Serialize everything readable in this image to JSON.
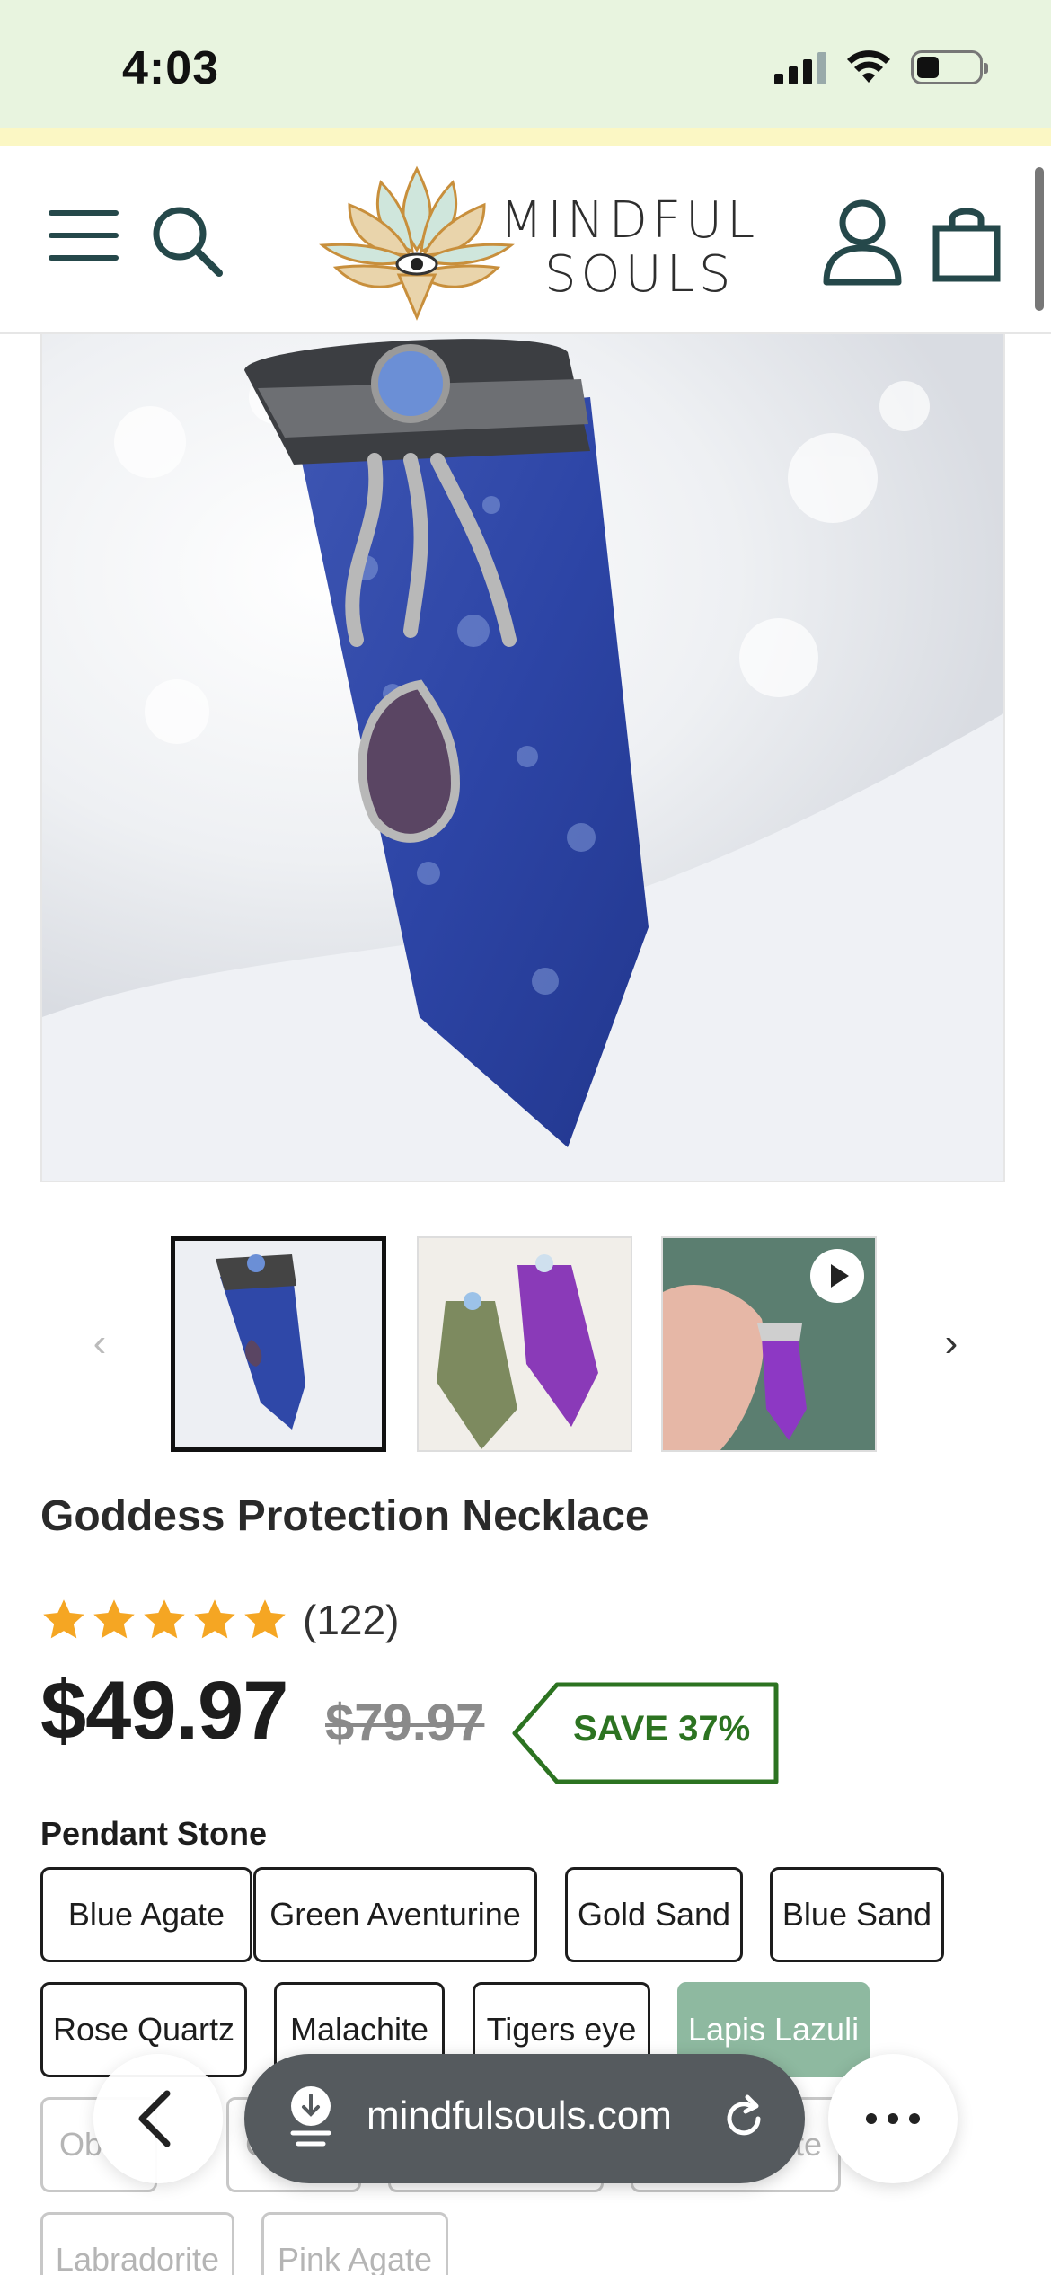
{
  "status_bar": {
    "time": "4:03"
  },
  "header": {
    "brand_line1": "MINDFUL",
    "brand_line2": "SOULS",
    "icons": [
      "menu-icon",
      "search-icon",
      "account-icon",
      "cart-icon"
    ]
  },
  "gallery": {
    "thumbnails": [
      "lapis-lazuli-pendant",
      "agate-and-amethyst-pendants",
      "purple-pendant-video"
    ],
    "selected_index": 0
  },
  "product": {
    "title": "Goddess Protection Necklace",
    "rating_stars": 5,
    "rating_count": "(122)",
    "price": "$49.97",
    "compare_price": "$79.97",
    "save_badge": "SAVE 37%"
  },
  "options": {
    "label": "Pendant Stone",
    "row1": [
      "Blue Agate",
      "Green Aventurine",
      "Gold Sand",
      "Blue Sand"
    ],
    "row2": [
      "Rose Quartz",
      "Malachite",
      "Tigers eye",
      "Lapis Lazuli"
    ],
    "row3": [
      "Ob",
      "C",
      "",
      "te"
    ],
    "row4": [
      "Labradorite",
      "Pink Agate"
    ],
    "selected": "Lapis Lazuli"
  },
  "browser_bar": {
    "url": "mindfulsouls.com"
  },
  "colors": {
    "accent_green": "#2c7321",
    "selected_option": "#8eb9a0",
    "star": "#f5a623",
    "status_bar_bg": "#e8f4df"
  }
}
